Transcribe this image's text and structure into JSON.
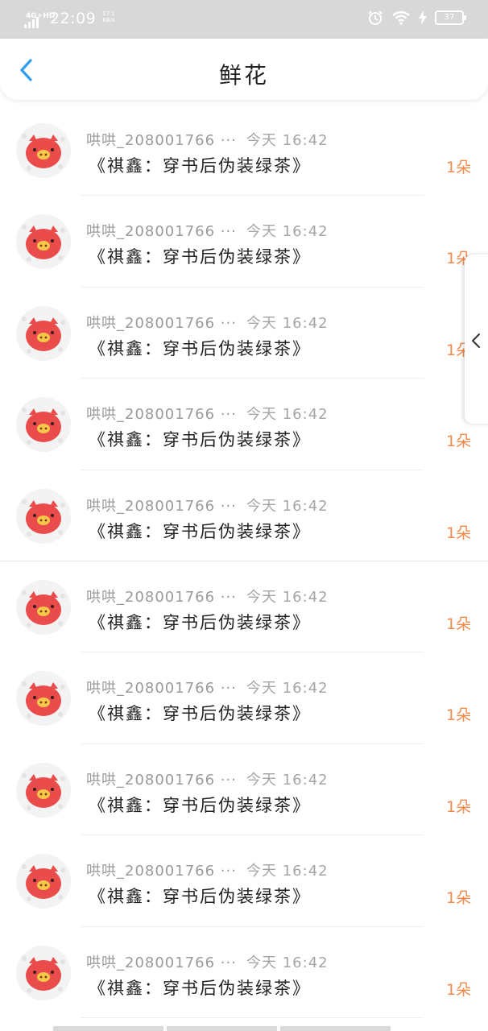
{
  "status_bar": {
    "network": "4G+HD",
    "time": "22:09",
    "speed_value": "17.1",
    "speed_unit": "KB/s",
    "battery": "37"
  },
  "header": {
    "title": "鲜花",
    "back_icon": "chevron-left-icon"
  },
  "colors": {
    "accent_blue": "#2e9df0",
    "count_orange": "#f08a4b",
    "avatar_red": "#ea4b4b"
  },
  "records": [
    {
      "name": "哄哄_208001766 ···",
      "time": "今天 16:42",
      "book": "《祺鑫：穿书后伪装绿茶》",
      "count": "1朵"
    },
    {
      "name": "哄哄_208001766 ···",
      "time": "今天 16:42",
      "book": "《祺鑫：穿书后伪装绿茶》",
      "count": "1朵"
    },
    {
      "name": "哄哄_208001766 ···",
      "time": "今天 16:42",
      "book": "《祺鑫：穿书后伪装绿茶》",
      "count": "1朵"
    },
    {
      "name": "哄哄_208001766 ···",
      "time": "今天 16:42",
      "book": "《祺鑫：穿书后伪装绿茶》",
      "count": "1朵"
    },
    {
      "name": "哄哄_208001766 ···",
      "time": "今天 16:42",
      "book": "《祺鑫：穿书后伪装绿茶》",
      "count": "1朵"
    },
    {
      "name": "哄哄_208001766 ···",
      "time": "今天 16:42",
      "book": "《祺鑫：穿书后伪装绿茶》",
      "count": "1朵"
    },
    {
      "name": "哄哄_208001766 ···",
      "time": "今天 16:42",
      "book": "《祺鑫：穿书后伪装绿茶》",
      "count": "1朵"
    },
    {
      "name": "哄哄_208001766 ···",
      "time": "今天 16:42",
      "book": "《祺鑫：穿书后伪装绿茶》",
      "count": "1朵"
    },
    {
      "name": "哄哄_208001766 ···",
      "time": "今天 16:42",
      "book": "《祺鑫：穿书后伪装绿茶》",
      "count": "1朵"
    },
    {
      "name": "哄哄_208001766 ···",
      "time": "今天 16:42",
      "book": "《祺鑫：穿书后伪装绿茶》",
      "count": "1朵"
    }
  ],
  "side_tab": {
    "icon": "chevron-left-icon"
  }
}
